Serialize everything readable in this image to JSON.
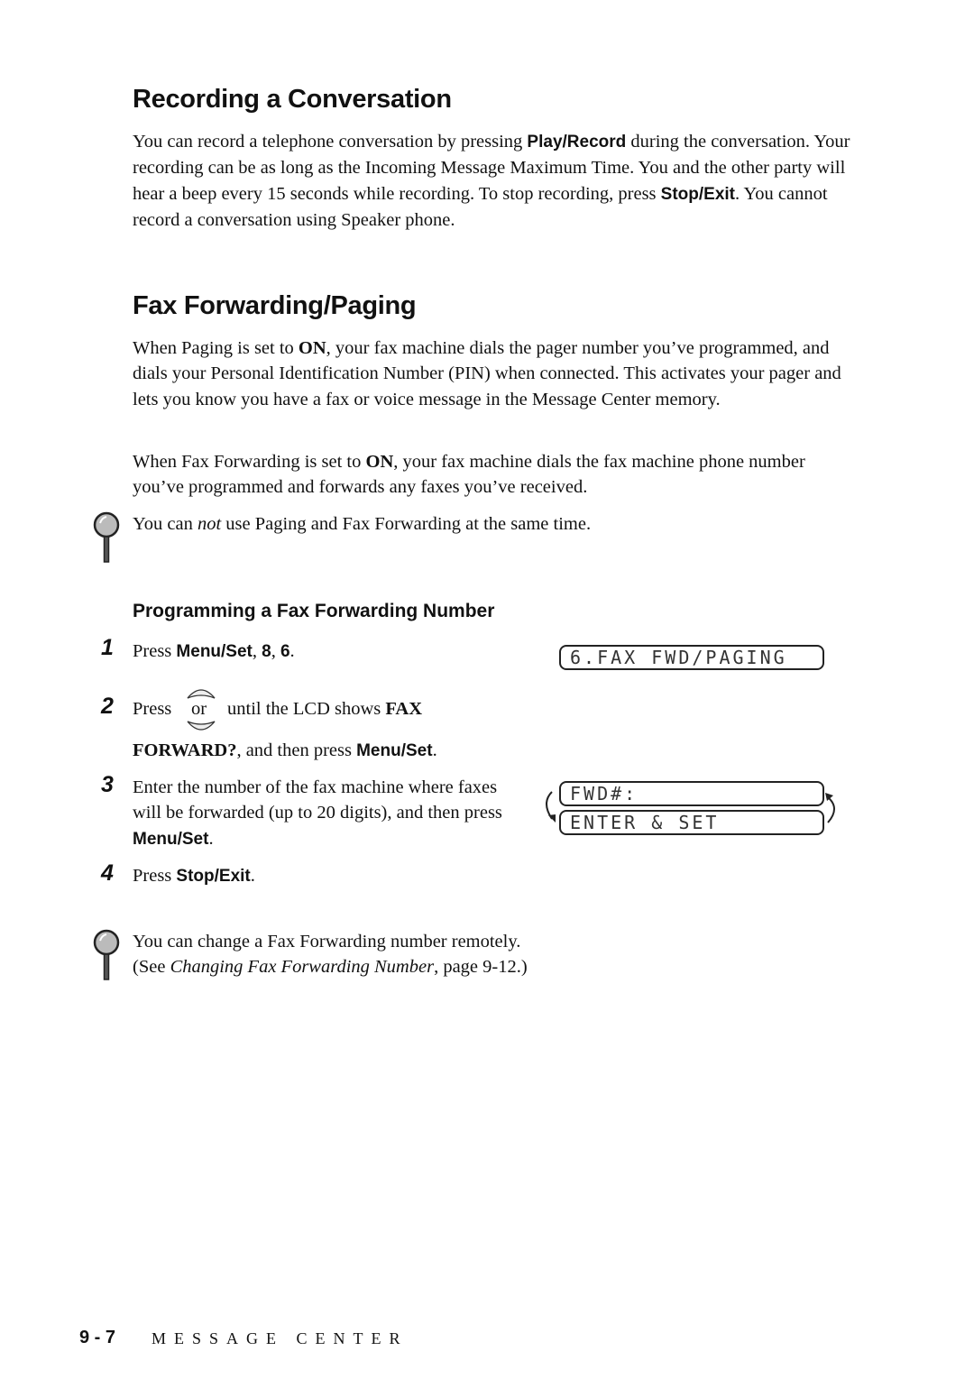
{
  "section1": {
    "title": "Recording a Conversation",
    "para": {
      "t1": "You can record a telephone conversation by pressing ",
      "b1": "Play/Record",
      "t2": " during the conversation. Your recording can be as long as the Incoming Message Maximum Time. You and the other party will hear a beep every 15 seconds while recording. To stop recording, press ",
      "b2": "Stop/Exit",
      "t3": ". You cannot record a conversation using Speaker phone."
    }
  },
  "section2": {
    "title": "Fax Forwarding/Paging",
    "para1": {
      "t1": "When Paging is set to ",
      "b1": "ON",
      "t2": ", your fax machine dials the pager number you’ve programmed, and dials your Personal Identification Number (PIN) when connected. This activates your pager and lets you know you have a fax or voice message in the Message Center memory."
    },
    "para2": {
      "t1": "When Fax Forwarding is set to ",
      "b1": "ON",
      "t2": ", your fax machine dials the fax machine phone number you’ve programmed and forwards any faxes you’ve received."
    },
    "note1": {
      "t1": "You can ",
      "i1": "not",
      "t2": " use Paging and Fax Forwarding at the same time."
    }
  },
  "subsection": {
    "title": "Programming a Fax Forwarding Number",
    "steps": [
      {
        "num": "1",
        "t1": "Press ",
        "b1": "Menu/Set",
        "t2": ", ",
        "b2": "8",
        "t3": ", ",
        "b3": "6",
        "t4": "."
      },
      {
        "num": "2",
        "t1": "Press",
        "or": "or",
        "t2": "until the LCD shows ",
        "bs1": "FAX",
        "bs2": "FORWARD?",
        "t3": ", and then press ",
        "b1": "Menu/Set",
        "t4": "."
      },
      {
        "num": "3",
        "t1": "Enter the number of the fax machine where faxes will be forwarded (up to 20 digits), and then press ",
        "b1": "Menu/Set",
        "t2": "."
      },
      {
        "num": "4",
        "t1": "Press ",
        "b1": "Stop/Exit",
        "t2": "."
      }
    ],
    "lcd1": "6.FAX FWD/PAGING",
    "lcd2": "FWD#:",
    "lcd3": "ENTER & SET",
    "note2": {
      "line1": "You can change a Fax Forwarding number remotely.",
      "t1": "(See ",
      "i1": "Changing Fax Forwarding Number",
      "t2": ", page 9-12.)"
    }
  },
  "footer": {
    "page": "9 - 7",
    "title": "MESSAGE CENTER"
  }
}
